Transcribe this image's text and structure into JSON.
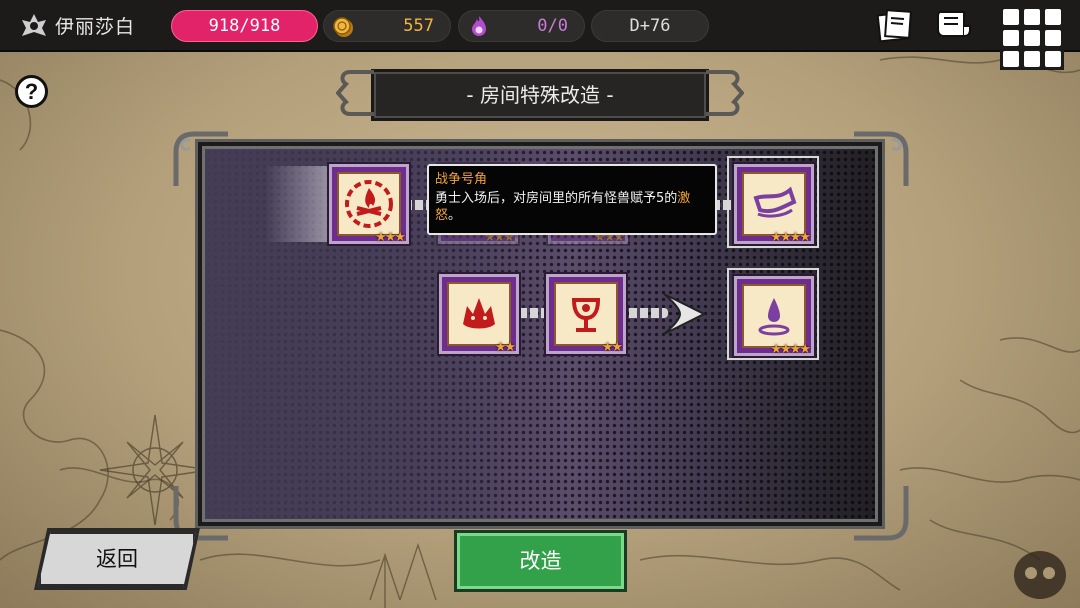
{
  "player": {
    "name": "伊丽莎白"
  },
  "stats": {
    "hp": "918/918",
    "gold": "557",
    "souls": "0/0",
    "day": "D+76"
  },
  "help": {
    "label": "?"
  },
  "title": "- 房间特殊改造 -",
  "tooltip": {
    "title": "战争号角",
    "body_before": "勇士入场后，对房间里的所有怪兽赋予5的",
    "body_highlight": "激怒",
    "body_after": "。"
  },
  "cards": {
    "row1": [
      {
        "icon": "campfire-gear-icon",
        "stars": "★★★",
        "state": "owned"
      },
      {
        "icon": "hidden-card-icon",
        "stars": "★★★",
        "state": "covered"
      },
      {
        "icon": "hidden-card-icon",
        "stars": "★★★",
        "state": "covered"
      },
      {
        "icon": "horn-icon",
        "stars": "★★★★",
        "state": "result"
      }
    ],
    "row2": [
      {
        "icon": "wolf-head-icon",
        "stars": "★★",
        "state": "owned"
      },
      {
        "icon": "goblet-icon",
        "stars": "★★",
        "state": "owned"
      },
      {
        "icon": "potion-drop-icon",
        "stars": "★★★★",
        "state": "result"
      }
    ]
  },
  "buttons": {
    "back": "返回",
    "modify": "改造"
  },
  "colors": {
    "hp_pill": "#e2236a",
    "gold_text": "#f2b63e",
    "soul_text": "#c87bd8",
    "modify_button": "#33a14a",
    "tooltip_highlight": "#f1a33a",
    "card_border": "#6d2c8e"
  },
  "icons": [
    "shield-emblem-icon",
    "gold-coin-icon",
    "soul-flame-icon",
    "card-book-icon",
    "scroll-icon",
    "grid-menu-icon",
    "help-icon",
    "chain-arrow-icon"
  ]
}
